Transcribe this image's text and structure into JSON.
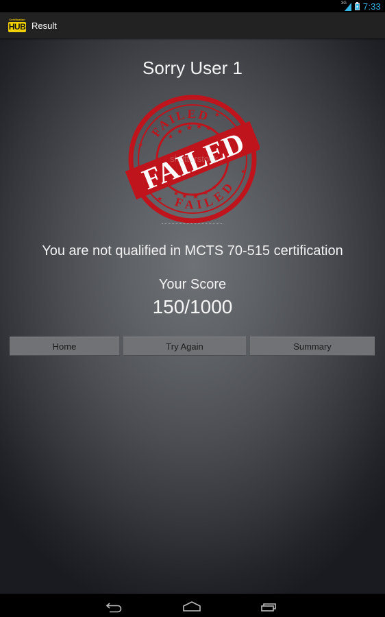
{
  "status_bar": {
    "network_label": "3G",
    "time": "7:33",
    "icons": [
      "signal-icon",
      "battery-charging-icon"
    ]
  },
  "action_bar": {
    "logo_small_text": "Certification",
    "logo_text": "HUB",
    "title": "Result"
  },
  "result": {
    "title": "Sorry User 1",
    "stamp": {
      "main_text": "FAILED",
      "ring_top_text": "FAILED",
      "ring_bottom_text": "FAILED",
      "watermark": "shutterstock"
    },
    "message": "You are not qualified in MCTS 70-515 certification",
    "score_label": "Your Score",
    "score_value": "150/1000"
  },
  "buttons": {
    "home": "Home",
    "try_again": "Try Again",
    "summary": "Summary"
  },
  "colors": {
    "accent_clock": "#33b5e5",
    "stamp_red": "#c0141c",
    "logo_yellow": "#f2d100"
  },
  "nav_bar": {
    "icons": [
      "back-icon",
      "home-icon",
      "recent-apps-icon"
    ]
  }
}
